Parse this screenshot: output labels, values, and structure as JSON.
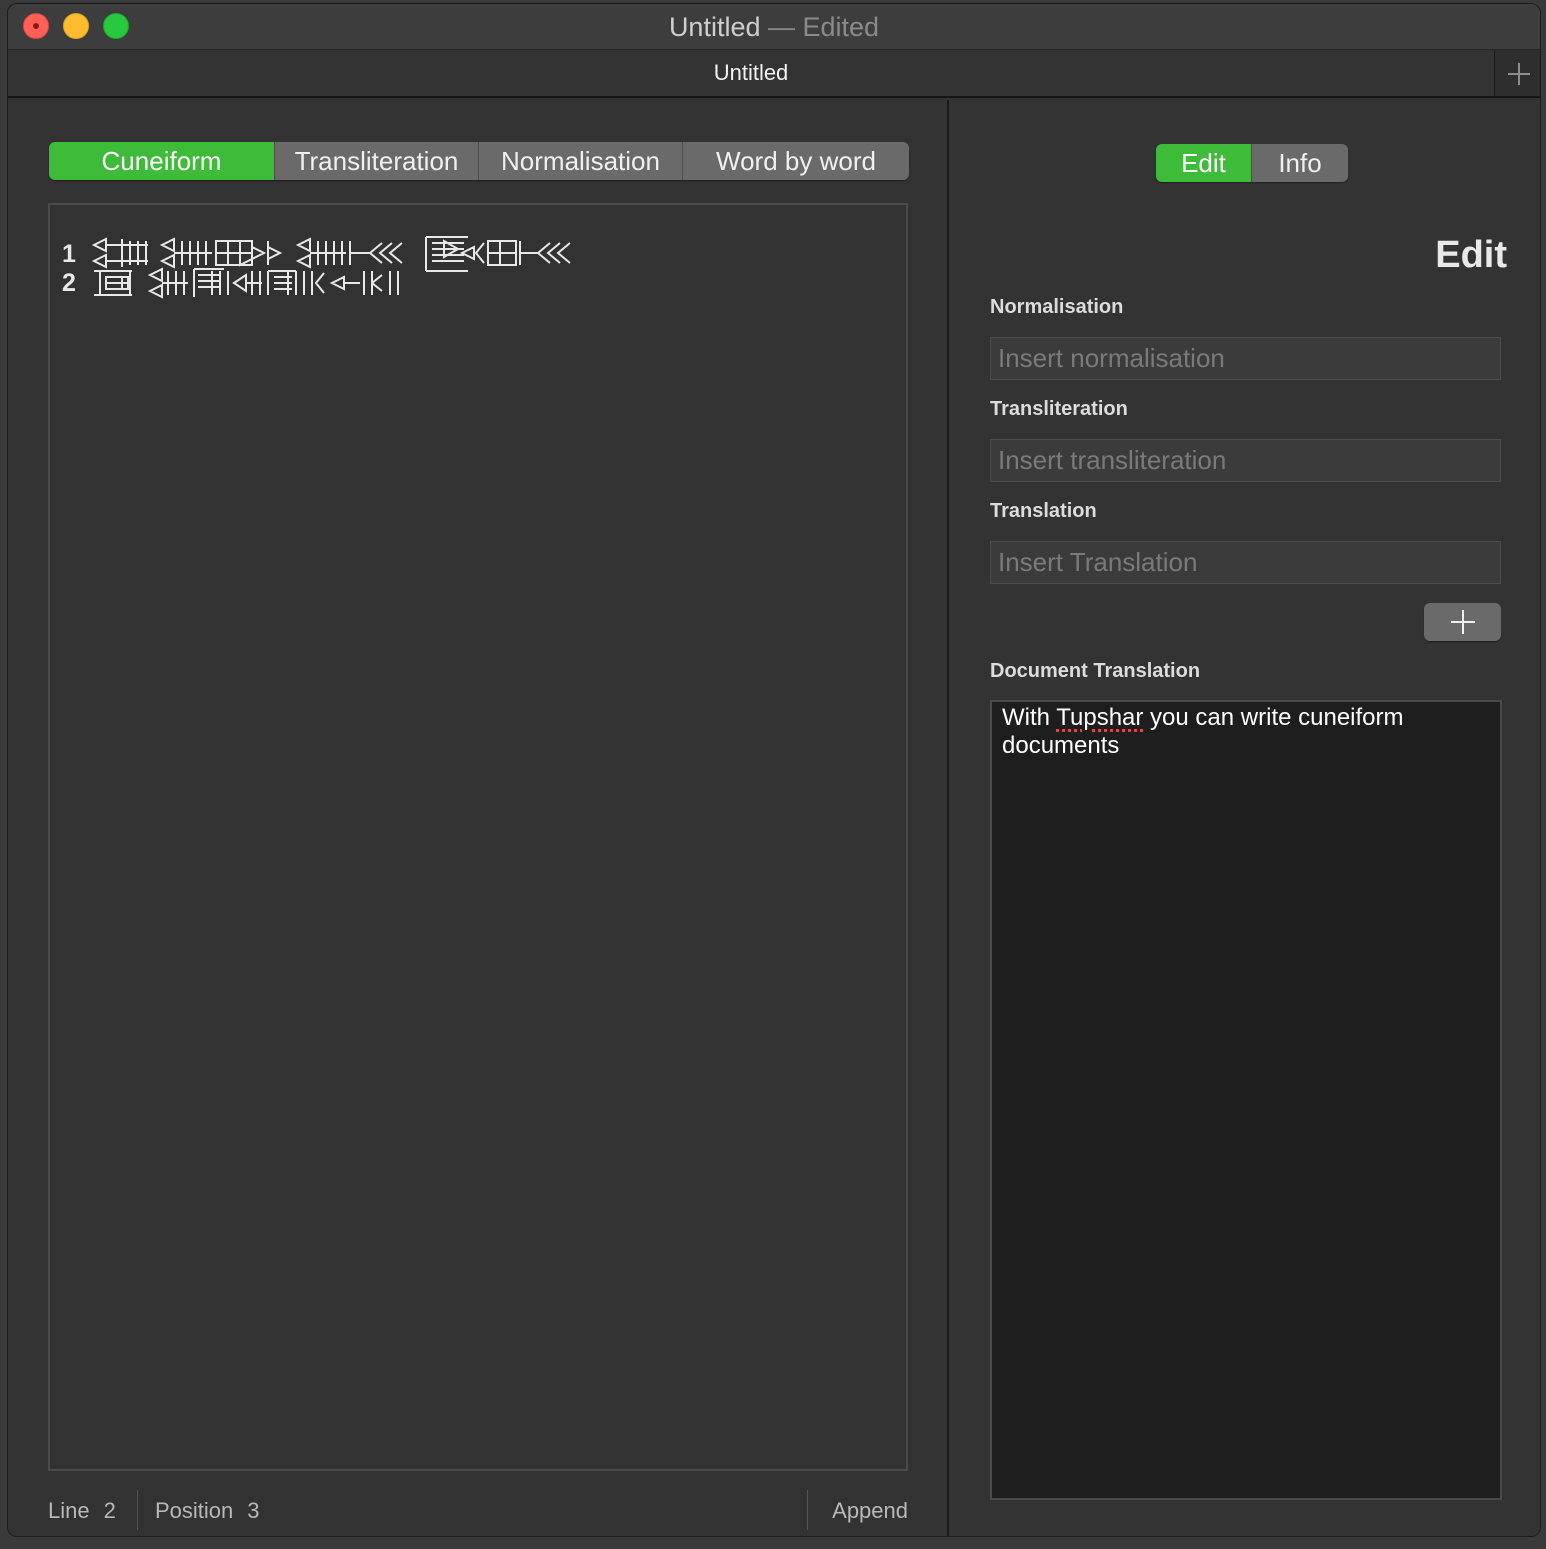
{
  "window": {
    "title": "Untitled",
    "edited_suffix": "— Edited"
  },
  "tab": {
    "title": "Untitled"
  },
  "view_tabs": [
    {
      "label": "Cuneiform",
      "active": true
    },
    {
      "label": "Transliteration",
      "active": false
    },
    {
      "label": "Normalisation",
      "active": false
    },
    {
      "label": "Word by word",
      "active": false
    }
  ],
  "editor": {
    "lines": [
      {
        "number": "1"
      },
      {
        "number": "2"
      }
    ]
  },
  "status": {
    "line_label": "Line",
    "line_value": "2",
    "position_label": "Position",
    "position_value": "3",
    "mode": "Append"
  },
  "panel": {
    "tabs": [
      {
        "label": "Edit",
        "active": true
      },
      {
        "label": "Info",
        "active": false
      }
    ],
    "title": "Edit",
    "normalisation": {
      "label": "Normalisation",
      "placeholder": "Insert normalisation",
      "value": ""
    },
    "transliteration": {
      "label": "Transliteration",
      "placeholder": "Insert transliteration",
      "value": ""
    },
    "translation": {
      "label": "Translation",
      "placeholder": "Insert Translation",
      "value": ""
    },
    "document_translation": {
      "label": "Document Translation",
      "text_before": "With ",
      "misspelled": "Tupshar",
      "text_after": " you can write cuneiform documents"
    }
  },
  "colors": {
    "accent_green": "#3fbb3a",
    "segment_gray": "#6a6a6a",
    "close": "#ff5f57",
    "minimize": "#febc2e",
    "maximize": "#28c840"
  }
}
